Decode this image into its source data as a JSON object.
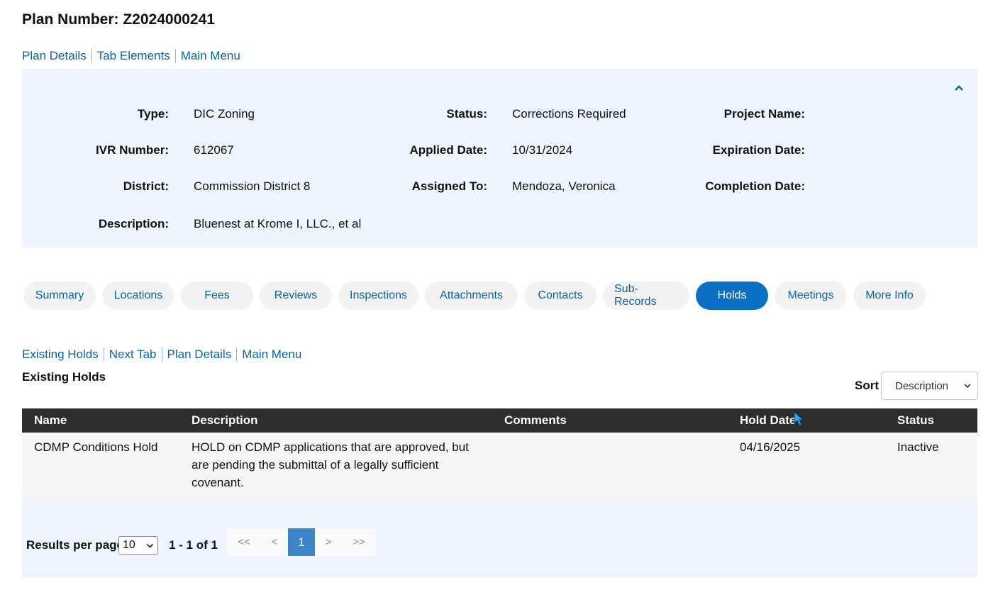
{
  "plan": {
    "title": "Plan Number: Z2024000241"
  },
  "top_links": [
    "Plan Details",
    "Tab Elements",
    "Main Menu"
  ],
  "details": {
    "type_label": "Type:",
    "type_value": "DIC Zoning",
    "status_label": "Status:",
    "status_value": "Corrections Required",
    "project_name_label": "Project Name:",
    "ivr_label": "IVR Number:",
    "ivr_value": "612067",
    "applied_label": "Applied Date:",
    "applied_value": "10/31/2024",
    "expiration_label": "Expiration Date:",
    "district_label": "District:",
    "district_value": "Commission District 8",
    "assigned_label": "Assigned To:",
    "assigned_value": "Mendoza, Veronica",
    "completion_label": "Completion Date:",
    "description_label": "Description:",
    "description_value": "Bluenest at Krome I, LLC., et al"
  },
  "tabs": [
    {
      "label": "Summary",
      "active": false
    },
    {
      "label": "Locations",
      "active": false
    },
    {
      "label": "Fees",
      "active": false
    },
    {
      "label": "Reviews",
      "active": false
    },
    {
      "label": "Inspections",
      "active": false
    },
    {
      "label": "Attachments",
      "active": false
    },
    {
      "label": "Contacts",
      "active": false
    },
    {
      "label": "Sub-Records",
      "active": false
    },
    {
      "label": "Holds",
      "active": true
    },
    {
      "label": "Meetings",
      "active": false
    },
    {
      "label": "More Info",
      "active": false
    }
  ],
  "holds_links": [
    "Existing Holds",
    "Next Tab",
    "Plan Details",
    "Main Menu"
  ],
  "holds": {
    "section_title": "Existing Holds",
    "sort_label": "Sort",
    "sort_value": "Description",
    "columns": [
      "Name",
      "Description",
      "Comments",
      "Hold Date",
      "Status"
    ],
    "rows": [
      {
        "name": "CDMP Conditions Hold",
        "description_lines": [
          "HOLD on CDMP applications that are approved, but",
          "are pending the submittal of a legally sufficient",
          "covenant."
        ],
        "comments": "",
        "hold_date": "04/16/2025",
        "status": "Inactive"
      }
    ]
  },
  "pagination": {
    "results_per_page_label": "Results per page",
    "results_per_page_value": "10",
    "range_text": "1 - 1 of 1",
    "first": "<<",
    "prev": "<",
    "current": "1",
    "next": ">",
    "last": ">>"
  },
  "colors": {
    "accent": "#0b6fc4",
    "link": "#0b62a8",
    "panel_bg": "#eef5fe",
    "header_bg": "#2d2d2d"
  }
}
